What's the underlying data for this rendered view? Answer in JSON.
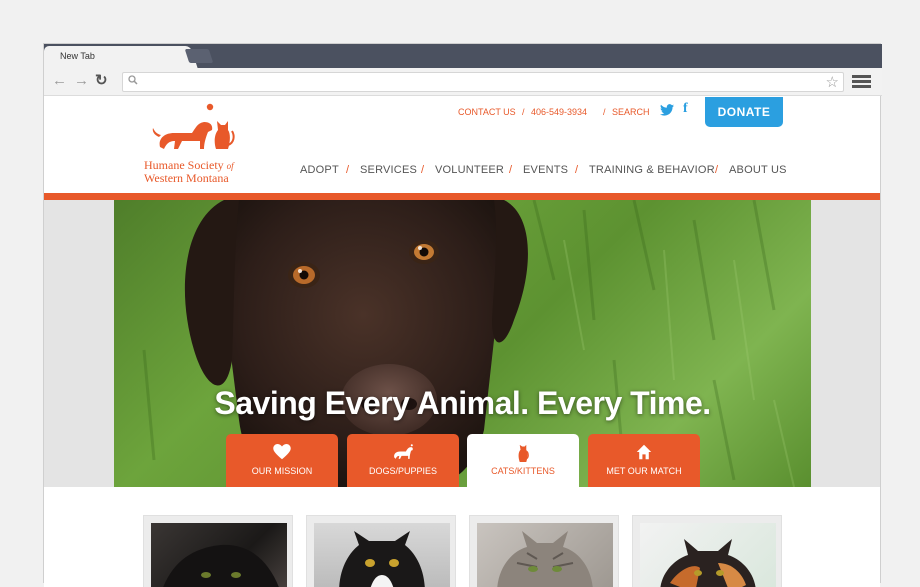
{
  "browser": {
    "tab_title": "New Tab",
    "back_icon": "back-arrow-icon",
    "forward_icon": "forward-arrow-icon",
    "reload_icon": "reload-icon",
    "search_icon": "search-icon",
    "star_icon": "star-icon",
    "menu_icon": "hamburger-menu-icon",
    "url": ""
  },
  "site": {
    "logo_line1": "Humane Society",
    "logo_of": "of",
    "logo_line2": "Western Montana",
    "utility": {
      "contact": "CONTACT US",
      "phone": "406-549-3934",
      "search": "SEARCH",
      "separator": "/"
    },
    "social": {
      "twitter_icon": "twitter-icon",
      "facebook_icon": "facebook-icon"
    },
    "donate_label": "DONATE",
    "nav": [
      "ADOPT",
      "SERVICES",
      "VOLUNTEER",
      "EVENTS",
      "TRAINING & BEHAVIOR",
      "ABOUT US"
    ],
    "nav_separator": "/",
    "hero_headline": "Saving Every Animal. Every Time.",
    "category_tabs": [
      {
        "label": "OUR MISSION",
        "icon": "heart-icon"
      },
      {
        "label": "DOGS/PUPPIES",
        "icon": "dog-icon"
      },
      {
        "label": "CATS/KITTENS",
        "icon": "cat-icon",
        "active": true
      },
      {
        "label": "MET OUR MATCH",
        "icon": "home-icon"
      }
    ],
    "cards": [
      {
        "name": "pet-card-black-cat"
      },
      {
        "name": "pet-card-tuxedo-cat"
      },
      {
        "name": "pet-card-tabby-cat"
      },
      {
        "name": "pet-card-calico-cat"
      }
    ]
  },
  "colors": {
    "brand_orange": "#e8592a",
    "donate_blue": "#2b9fe0",
    "chrome_dark": "#4b5160"
  }
}
